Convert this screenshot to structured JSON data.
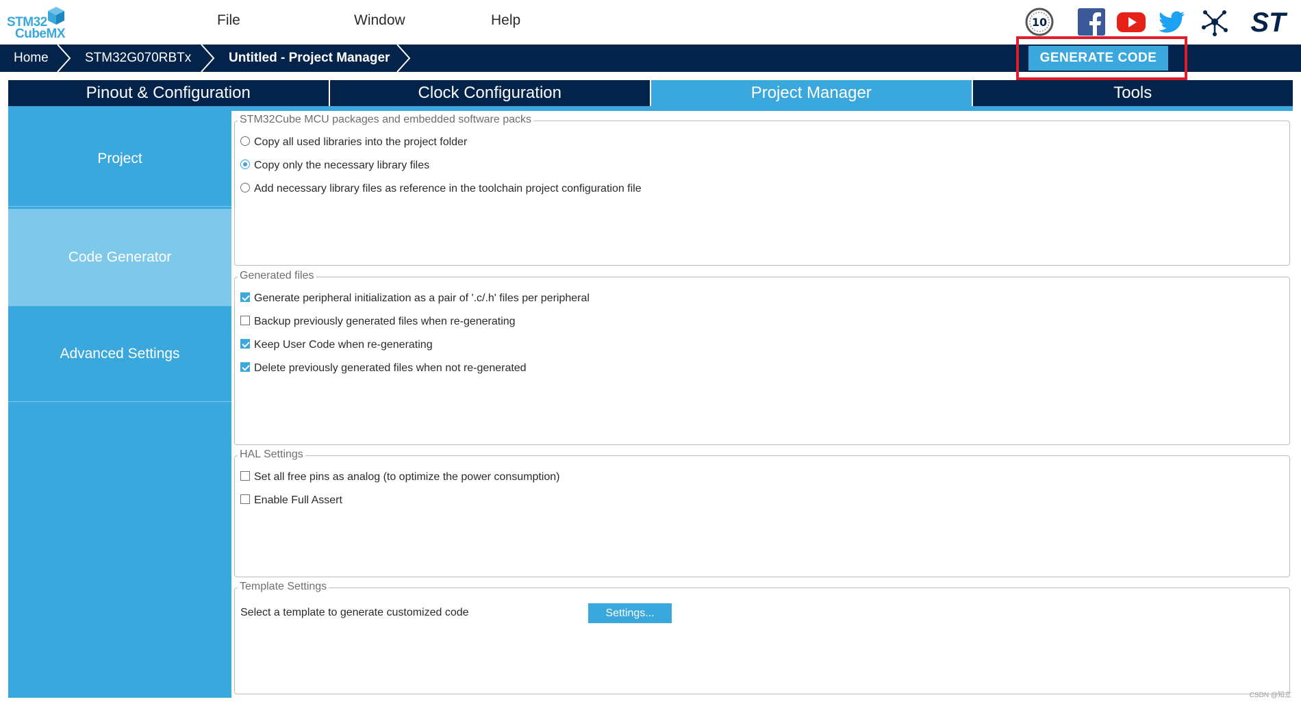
{
  "app": {
    "logo_line1": "STM32",
    "logo_line2": "CubeMX",
    "logo_icon": "cube-icon"
  },
  "menu": {
    "items": [
      {
        "label": "File"
      },
      {
        "label": "Window"
      },
      {
        "label": "Help"
      }
    ]
  },
  "social": {
    "icons": [
      "anniversary-10-badge-icon",
      "facebook-icon",
      "youtube-icon",
      "twitter-icon",
      "network-icon",
      "st-logo-icon"
    ],
    "badge_text": "10",
    "st_logo_text": "ST"
  },
  "breadcrumb": {
    "items": [
      {
        "label": "Home"
      },
      {
        "label": "STM32G070RBTx"
      },
      {
        "label": "Untitled - Project Manager"
      }
    ]
  },
  "toolbar": {
    "generate_label": "GENERATE CODE",
    "highlight_color": "#e01d2a"
  },
  "tabs": [
    {
      "label": "Pinout & Configuration",
      "active": false
    },
    {
      "label": "Clock Configuration",
      "active": false
    },
    {
      "label": "Project Manager",
      "active": true
    },
    {
      "label": "Tools",
      "active": false
    }
  ],
  "sidebar": {
    "items": [
      {
        "label": "Project",
        "active": false
      },
      {
        "label": "Code Generator",
        "active": true
      },
      {
        "label": "Advanced Settings",
        "active": false
      }
    ]
  },
  "packages": {
    "title": "STM32Cube MCU packages and embedded software packs",
    "options": [
      {
        "label": "Copy all used libraries into the project folder",
        "selected": false
      },
      {
        "label": "Copy only the necessary library files",
        "selected": true
      },
      {
        "label": "Add necessary library files as reference in the toolchain project configuration file",
        "selected": false
      }
    ]
  },
  "generated_files": {
    "title": "Generated files",
    "options": [
      {
        "label": "Generate peripheral initialization as a pair of '.c/.h' files per peripheral",
        "checked": true
      },
      {
        "label": "Backup previously generated files when re-generating",
        "checked": false
      },
      {
        "label": "Keep User Code when re-generating",
        "checked": true
      },
      {
        "label": "Delete previously generated files when not re-generated",
        "checked": true
      }
    ]
  },
  "hal_settings": {
    "title": "HAL Settings",
    "options": [
      {
        "label": "Set all free pins as analog (to optimize the power consumption)",
        "checked": false
      },
      {
        "label": "Enable Full Assert",
        "checked": false
      }
    ]
  },
  "template_settings": {
    "title": "Template Settings",
    "description": "Select a template to generate customized code",
    "button_label": "Settings..."
  },
  "colors": {
    "accent": "#3aa7dd",
    "navy": "#03234b",
    "sidebar_active": "#7ec8ea"
  },
  "watermark": "CSDN @知立"
}
